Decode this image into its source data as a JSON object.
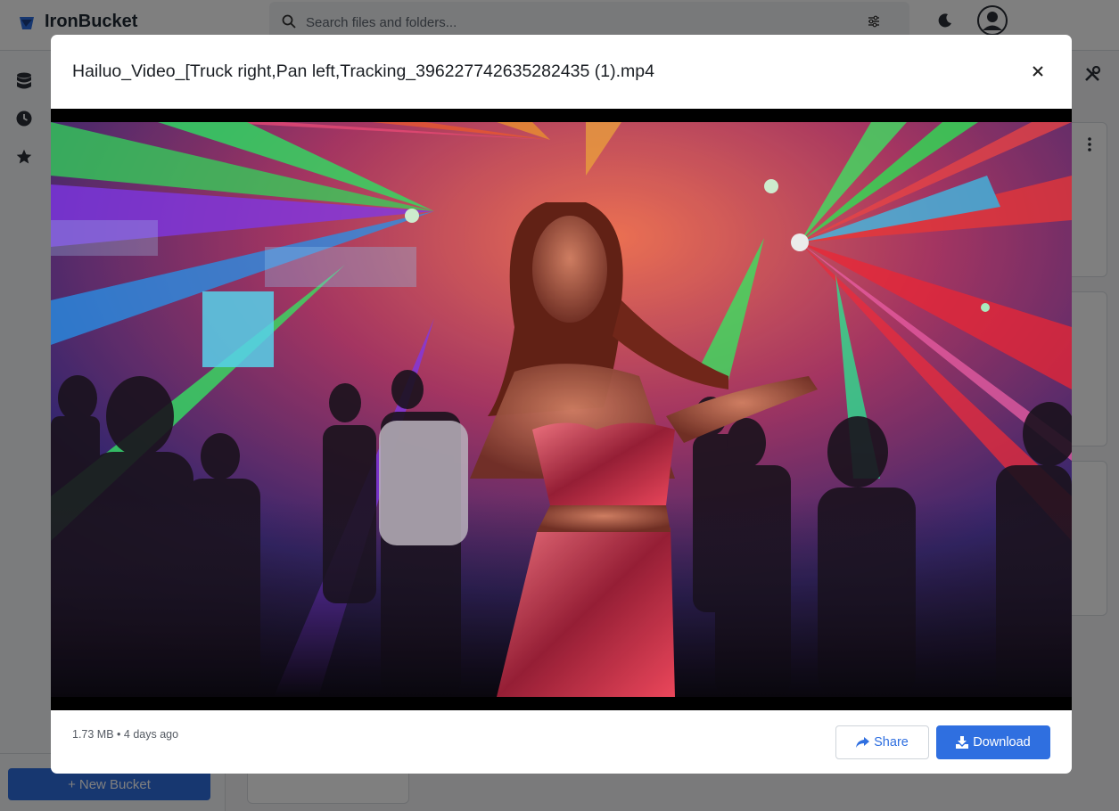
{
  "app": {
    "name": "IronBucket",
    "search_placeholder": "Search files and folders...",
    "new_bucket_label": "New Bucket"
  },
  "icons": {
    "logo": "ironbucket-logo-icon",
    "search": "search-icon",
    "filter": "sliders-icon",
    "theme": "moon-icon",
    "avatar": "user-avatar-icon",
    "sidebar": [
      "database-icon",
      "clock-icon",
      "star-icon"
    ],
    "tools": "tools-icon",
    "more": "kebab-menu-icon",
    "close": "close-icon",
    "share": "share-icon",
    "download": "download-icon"
  },
  "modal": {
    "title": "Hailuo_Video_[Truck right,Pan left,Tracking_396227742635282435 (1).mp4",
    "file_size": "1.73 MB",
    "separator": "•",
    "modified": "4 days ago",
    "share_label": "Share",
    "download_label": "Download"
  },
  "colors": {
    "accent": "#2f6fe0",
    "overlay": "rgba(0,0,0,0.5)"
  }
}
